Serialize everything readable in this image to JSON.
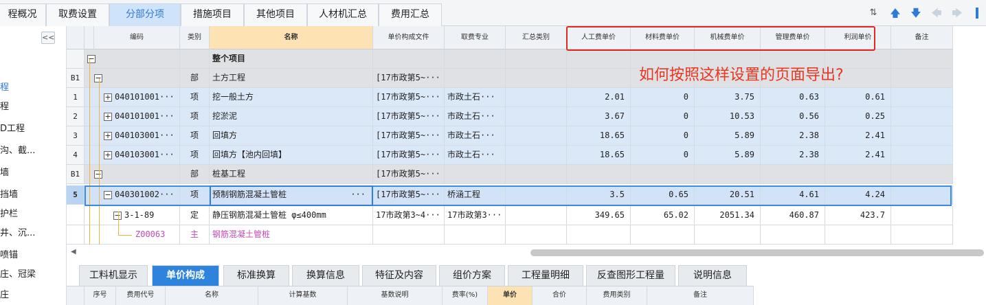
{
  "top_tabs": [
    {
      "label": "程概况"
    },
    {
      "label": "取费设置"
    },
    {
      "label": "分部分项"
    },
    {
      "label": "措施项目"
    },
    {
      "label": "其他项目"
    },
    {
      "label": "人材机汇总"
    },
    {
      "label": "费用汇总"
    }
  ],
  "active_top_tab": "分部分项",
  "sidebar": {
    "collapse_label": "<<",
    "items": [
      {
        "label": "程"
      },
      {
        "label": "程"
      },
      {
        "label": "D工程"
      },
      {
        "label": "沟、截..."
      },
      {
        "label": "墙"
      },
      {
        "label": "挡墙"
      },
      {
        "label": "护栏"
      },
      {
        "label": "井、沉..."
      },
      {
        "label": "喷锚"
      },
      {
        "label": "庄、冠梁"
      },
      {
        "label": "庄"
      }
    ]
  },
  "grid": {
    "headers": [
      "",
      "",
      "编码",
      "类别",
      "名称",
      "单价构成文件",
      "取费专业",
      "汇总类别",
      "人工费单价",
      "材料费单价",
      "机械费单价",
      "管理费单价",
      "利润单价",
      "备注"
    ],
    "rows": [
      {
        "no": "",
        "code": "",
        "type": "",
        "name": "整个项目",
        "file": "",
        "prof": "",
        "labor": "",
        "material": "",
        "machine": "",
        "mgmt": "",
        "profit": ""
      },
      {
        "no": "B1",
        "code": "",
        "type": "部",
        "name": "土方工程",
        "file": "[17市政第5~···",
        "prof": "",
        "labor": "",
        "material": "",
        "machine": "",
        "mgmt": "",
        "profit": ""
      },
      {
        "no": "1",
        "code": "040101001···",
        "type": "项",
        "name": "挖一般土方",
        "file": "[17市政第5~···",
        "prof": "市政土石···",
        "labor": "2.01",
        "material": "0",
        "machine": "3.75",
        "mgmt": "0.63",
        "profit": "0.61"
      },
      {
        "no": "2",
        "code": "040101001···",
        "type": "项",
        "name": "挖淤泥",
        "file": "[17市政第5~···",
        "prof": "市政土石···",
        "labor": "3.67",
        "material": "0",
        "machine": "10.53",
        "mgmt": "0.56",
        "profit": "0.25"
      },
      {
        "no": "3",
        "code": "040103001···",
        "type": "项",
        "name": "回填方",
        "file": "[17市政第5~···",
        "prof": "市政土石···",
        "labor": "18.65",
        "material": "0",
        "machine": "5.89",
        "mgmt": "2.38",
        "profit": "2.41"
      },
      {
        "no": "4",
        "code": "040103001···",
        "type": "项",
        "name": "回填方【池内回填】",
        "file": "[17市政第5~···",
        "prof": "市政土石···",
        "labor": "18.65",
        "material": "0",
        "machine": "5.89",
        "mgmt": "2.38",
        "profit": "2.41"
      },
      {
        "no": "B1",
        "code": "",
        "type": "部",
        "name": "桩基工程",
        "file": "[17市政第5~···",
        "prof": "",
        "labor": "",
        "material": "",
        "machine": "",
        "mgmt": "",
        "profit": ""
      },
      {
        "no": "5",
        "code": "040301002···",
        "type": "项",
        "name": "预制钢筋混凝土管桩",
        "file": "[17市政第5~···",
        "prof": "桥涵工程",
        "labor": "3.5",
        "material": "0.65",
        "machine": "20.51",
        "mgmt": "4.61",
        "profit": "4.24"
      },
      {
        "no": "",
        "code": "3-1-89",
        "type": "定",
        "name": "静压钢筋混凝土管桩 φ≤400mm",
        "file": "17市政第3~4···",
        "prof": "17市政第3···",
        "labor": "349.65",
        "material": "65.02",
        "machine": "2051.34",
        "mgmt": "460.87",
        "profit": "423.7"
      },
      {
        "no": "",
        "code": "Z00063",
        "type": "主",
        "name": "钢筋混凝土管桩",
        "file": "",
        "prof": "",
        "labor": "",
        "material": "",
        "machine": "",
        "mgmt": "",
        "profit": ""
      }
    ],
    "ellipsis": "···"
  },
  "annotation": "如何按照这样设置的页面导出?",
  "bottom_tabs": [
    {
      "label": "工料机显示"
    },
    {
      "label": "单价构成"
    },
    {
      "label": "标准换算"
    },
    {
      "label": "换算信息"
    },
    {
      "label": "特征及内容"
    },
    {
      "label": "组价方案"
    },
    {
      "label": "工程量明细"
    },
    {
      "label": "反查图形工程量"
    },
    {
      "label": "说明信息"
    }
  ],
  "active_bottom_tab": "单价构成",
  "bottom_headers": [
    "序号",
    "费用代号",
    "名称",
    "计算基数",
    "基数说明",
    "费率(%)",
    "单价",
    "合价",
    "费用类别",
    "备注"
  ],
  "colors": {
    "accent": "#2e84dc",
    "annotation": "#e8361f",
    "header_highlight": "#fde3b4",
    "selection": "#3d8ae2"
  },
  "toolbar_icons": [
    "sort-icon",
    "arrow-up-icon",
    "arrow-down-icon",
    "arrow-left-icon",
    "arrow-right-icon"
  ]
}
